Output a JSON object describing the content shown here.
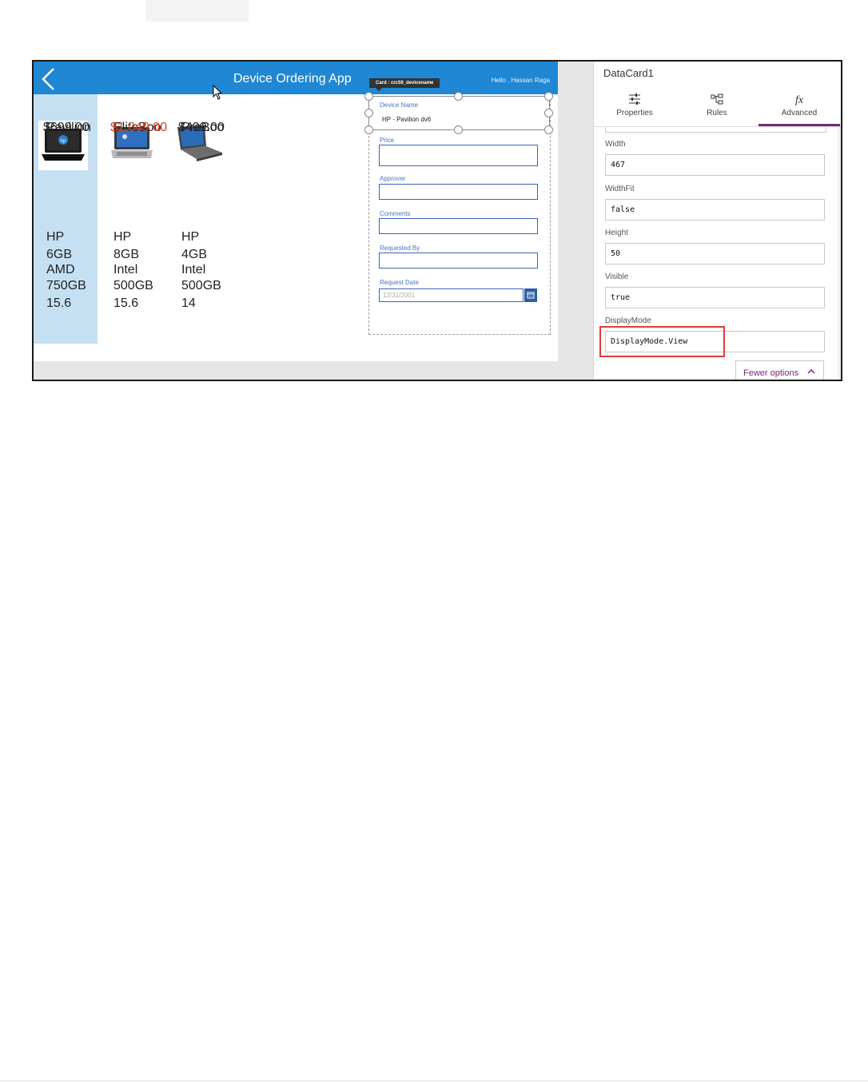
{
  "app": {
    "title": "Device Ordering App",
    "greeting": "Hello , Hassan Raga",
    "tooltip": "Card : crc59_devicename"
  },
  "devices": [
    {
      "name": "Pavilion",
      "price": "$699.00",
      "brand": "HP",
      "ram": "6GB",
      "cpu": "AMD",
      "storage": "750GB",
      "screen": "15.6",
      "image_icon": "laptop-hp-icon"
    },
    {
      "name": "EliteBoo",
      "price": "$1,049.00",
      "brand": "HP",
      "ram": "8GB",
      "cpu": "Intel",
      "storage": "500GB",
      "screen": "15.6",
      "image_icon": "laptop-icon"
    },
    {
      "name": "ProBoo",
      "price": "$499.00",
      "brand": "HP",
      "ram": "4GB",
      "cpu": "Intel",
      "storage": "500GB",
      "screen": "14",
      "image_icon": "laptop-icon"
    }
  ],
  "form": {
    "device_name_label": "Device Name",
    "device_name_value": "HP - Pavilion dv6",
    "price_label": "Price",
    "approver_label": "Approver",
    "comments_label": "Comments",
    "requested_by_label": "Requested By",
    "request_date_label": "Request Date",
    "request_date_value": "12/31/2001"
  },
  "panel": {
    "title": "DataCard1",
    "tabs": [
      {
        "label": "Properties",
        "icon": "sliders-icon"
      },
      {
        "label": "Rules",
        "icon": "rules-icon"
      },
      {
        "label": "Advanced",
        "icon": "fx-icon",
        "active": true
      }
    ],
    "fields": [
      {
        "label": "Width",
        "value": "467"
      },
      {
        "label": "WidthFit",
        "value": "false"
      },
      {
        "label": "Height",
        "value": "50"
      },
      {
        "label": "Visible",
        "value": "true"
      },
      {
        "label": "DisplayMode",
        "value": "DisplayMode.View"
      }
    ],
    "fewer_options": "Fewer options"
  },
  "colors": {
    "app_bar": "#1f87d3",
    "selection": "#c6e0f3",
    "accent": "#742774",
    "price_highlight": "#e03c1b",
    "annotation": "#e03b3b"
  }
}
